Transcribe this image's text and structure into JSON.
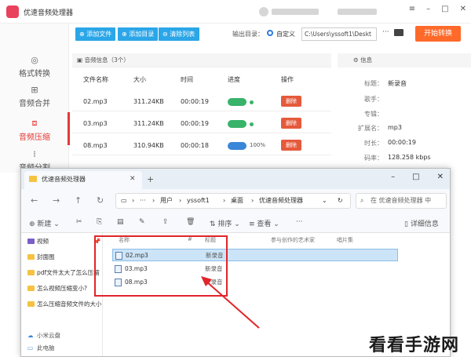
{
  "app": {
    "title": "优速音频处理器",
    "icon": "music-app-icon"
  },
  "sidebar": {
    "items": [
      {
        "label": "格式转换",
        "icon": "convert-icon"
      },
      {
        "label": "音频合并",
        "icon": "merge-icon"
      },
      {
        "label": "音频压缩",
        "icon": "compress-icon",
        "active": true
      },
      {
        "label": "音频分割",
        "icon": "split-icon"
      }
    ]
  },
  "toolbar": {
    "add_file": "添加文件",
    "add_folder": "添加目录",
    "clear_list": "清除列表",
    "output_label": "输出目录：",
    "custom_label": "自定义",
    "output_path": "C:\\Users\\yssoft1\\Deskt",
    "more": "···",
    "start": "开始转换"
  },
  "file_list": {
    "header": "音频信息（3个）",
    "columns": [
      "文件名称",
      "大小",
      "时间",
      "进度",
      "操作"
    ],
    "rows": [
      {
        "name": "02.mp3",
        "size": "311.24KB",
        "time": "00:00:19",
        "progress_label": "",
        "status_color": "#38b36a",
        "action": "删除"
      },
      {
        "name": "03.mp3",
        "size": "311.24KB",
        "time": "00:00:19",
        "progress_label": "",
        "status_color": "#38b36a",
        "action": "删除"
      },
      {
        "name": "08.mp3",
        "size": "310.94KB",
        "time": "00:00:18",
        "progress_label": "100%",
        "status_color": "#3a86d8",
        "action": "删除"
      }
    ]
  },
  "info": {
    "header": "信息",
    "rows": [
      {
        "k": "标题：",
        "v": "新录音"
      },
      {
        "k": "歌手：",
        "v": ""
      },
      {
        "k": "专辑：",
        "v": ""
      },
      {
        "k": "扩展名：",
        "v": "mp3"
      },
      {
        "k": "时长：",
        "v": "00:00:19"
      },
      {
        "k": "码率：",
        "v": "128.258 kbps"
      }
    ]
  },
  "explorer": {
    "tab_title": "优速音频处理器",
    "breadcrumb": [
      "用户",
      "yssoft1",
      "桌面",
      "优速音频处理器"
    ],
    "search_placeholder": "在 优速音频处理器 中",
    "new_label": "新建",
    "sort_label": "排序",
    "view_label": "查看",
    "details_label": "详细信息",
    "nav_items": [
      {
        "label": "视频",
        "pinned": true
      },
      {
        "label": "封面图"
      },
      {
        "label": "pdf文件太大了怎么压缩"
      },
      {
        "label": "怎么视频压缩变小?"
      },
      {
        "label": "怎么压缩音频文件的大小"
      }
    ],
    "nav_bottom": [
      {
        "label": "小米云盘"
      },
      {
        "label": "此电脑"
      }
    ],
    "columns": [
      "名称",
      "#",
      "标题",
      "参与创作的艺术家",
      "唱片集"
    ],
    "files": [
      {
        "name": "02.mp3",
        "title": "新录音",
        "selected": true
      },
      {
        "name": "03.mp3",
        "title": "新录音"
      },
      {
        "name": "08.mp3",
        "title": "新录音"
      }
    ]
  },
  "watermark": "看看手游网"
}
